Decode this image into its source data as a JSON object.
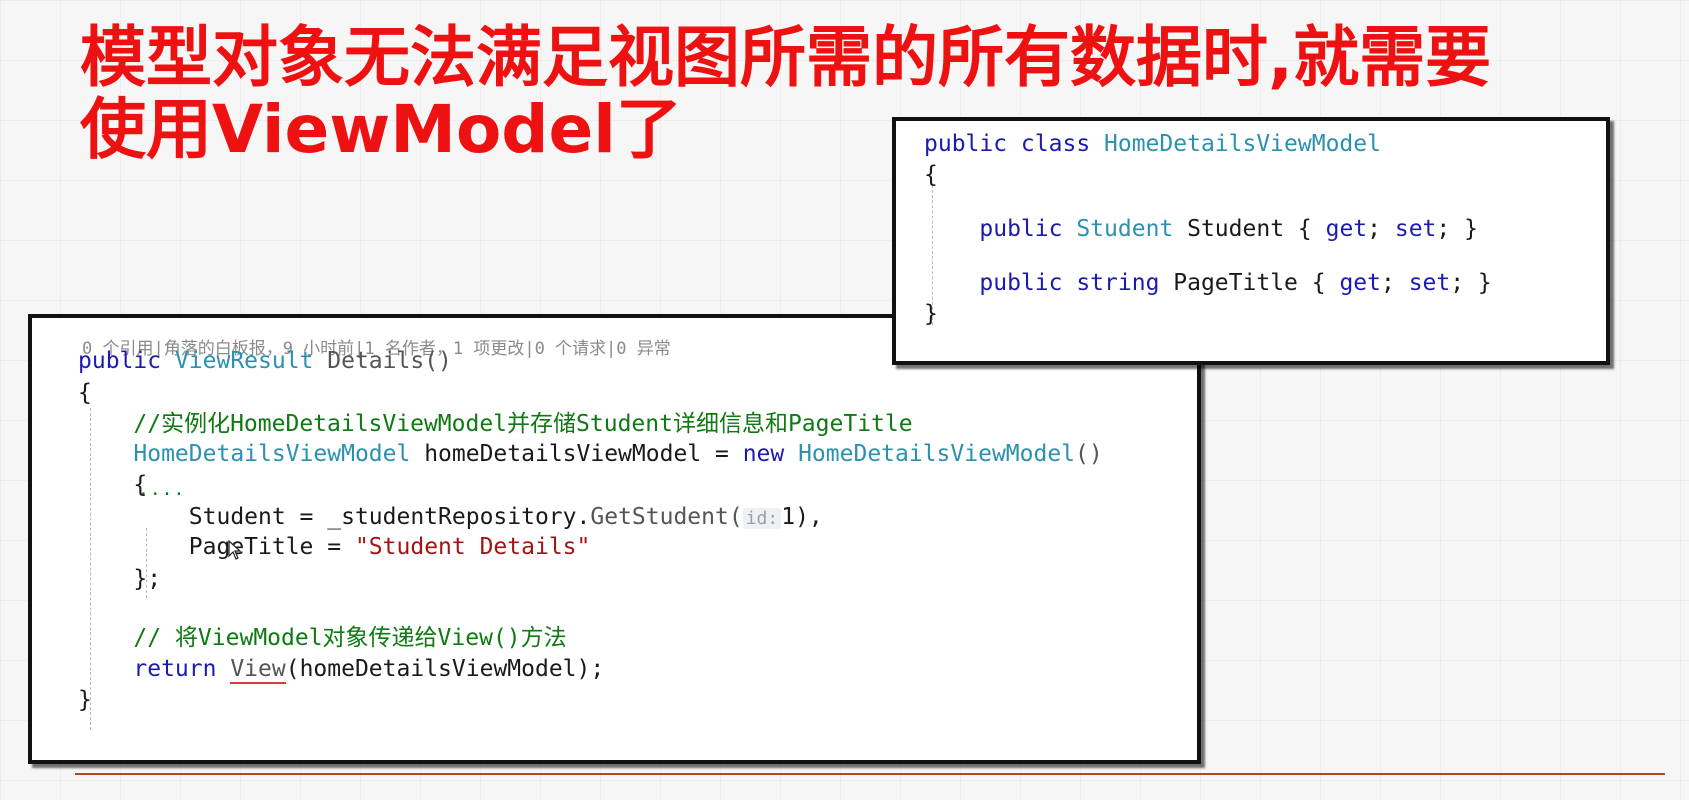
{
  "slide": {
    "title_line1": "模型对象无法满足视图所需的所有数据时,就需要",
    "title_line2": "使用ViewModel了",
    "accent_color": "#ee1111"
  },
  "class_panel": {
    "lines": [
      [
        {
          "t": "public class ",
          "c": "kw"
        },
        {
          "t": "HomeDetailsViewModel",
          "c": "ty"
        }
      ],
      [
        {
          "t": "{",
          "c": ""
        }
      ],
      [
        {
          "t": "    public ",
          "c": "kw"
        },
        {
          "t": "Student",
          "c": "ty"
        },
        {
          "t": " Student { ",
          "c": ""
        },
        {
          "t": "get",
          "c": "kw"
        },
        {
          "t": "; ",
          "c": ""
        },
        {
          "t": "set",
          "c": "kw"
        },
        {
          "t": "; }",
          "c": ""
        }
      ],
      [
        {
          "t": "    public ",
          "c": "kw"
        },
        {
          "t": "string",
          "c": "kw"
        },
        {
          "t": " PageTitle { ",
          "c": ""
        },
        {
          "t": "get",
          "c": "kw"
        },
        {
          "t": "; ",
          "c": ""
        },
        {
          "t": "set",
          "c": "kw"
        },
        {
          "t": "; }",
          "c": ""
        }
      ],
      [
        {
          "t": "}",
          "c": ""
        }
      ]
    ]
  },
  "method_panel": {
    "codelens": "0 个引用|角落的白板报，9 小时前|1 名作者，1 项更改|0 个请求|0 异常",
    "lines": [
      [
        {
          "t": "public ",
          "c": "kw"
        },
        {
          "t": "ViewResult",
          "c": "ty"
        },
        {
          "t": " Details()",
          "c": "meth"
        }
      ],
      [
        {
          "t": "{",
          "c": ""
        }
      ],
      [
        {
          "t": "    //实例化HomeDetailsViewModel并存储Student详细信息和PageTitle",
          "c": "cm"
        }
      ],
      [
        {
          "t": "    ",
          "c": ""
        },
        {
          "t": "HomeDetailsViewModel",
          "c": "ty"
        },
        {
          "t": " homeDetailsViewModel = ",
          "c": ""
        },
        {
          "t": "new ",
          "c": "kw"
        },
        {
          "t": "HomeDetailsViewModel",
          "c": "ty"
        },
        {
          "t": "()",
          "c": "meth"
        }
      ],
      [
        {
          "t": "    {",
          "c": ""
        }
      ],
      [
        {
          "t": "        Student = _studentRepository.",
          "c": ""
        },
        {
          "t": "GetStudent",
          "c": "meth"
        },
        {
          "t": "(",
          "c": "meth"
        },
        {
          "t": "id:",
          "c": "hint"
        },
        {
          "t": "1),",
          "c": ""
        }
      ],
      [
        {
          "t": "        PageTitle = ",
          "c": ""
        },
        {
          "t": "\"Student Details\"",
          "c": "st"
        }
      ],
      [
        {
          "t": "    };",
          "c": ""
        }
      ],
      [
        {
          "t": "",
          "c": ""
        }
      ],
      [
        {
          "t": "    // 将ViewModel对象传递给View()方法",
          "c": "cm"
        }
      ],
      [
        {
          "t": "    ",
          "c": ""
        },
        {
          "t": "return ",
          "c": "kw"
        },
        {
          "t": "View",
          "c": "sq"
        },
        {
          "t": "(homeDetailsViewModel);",
          "c": ""
        }
      ],
      [
        {
          "t": "}",
          "c": ""
        }
      ]
    ]
  }
}
